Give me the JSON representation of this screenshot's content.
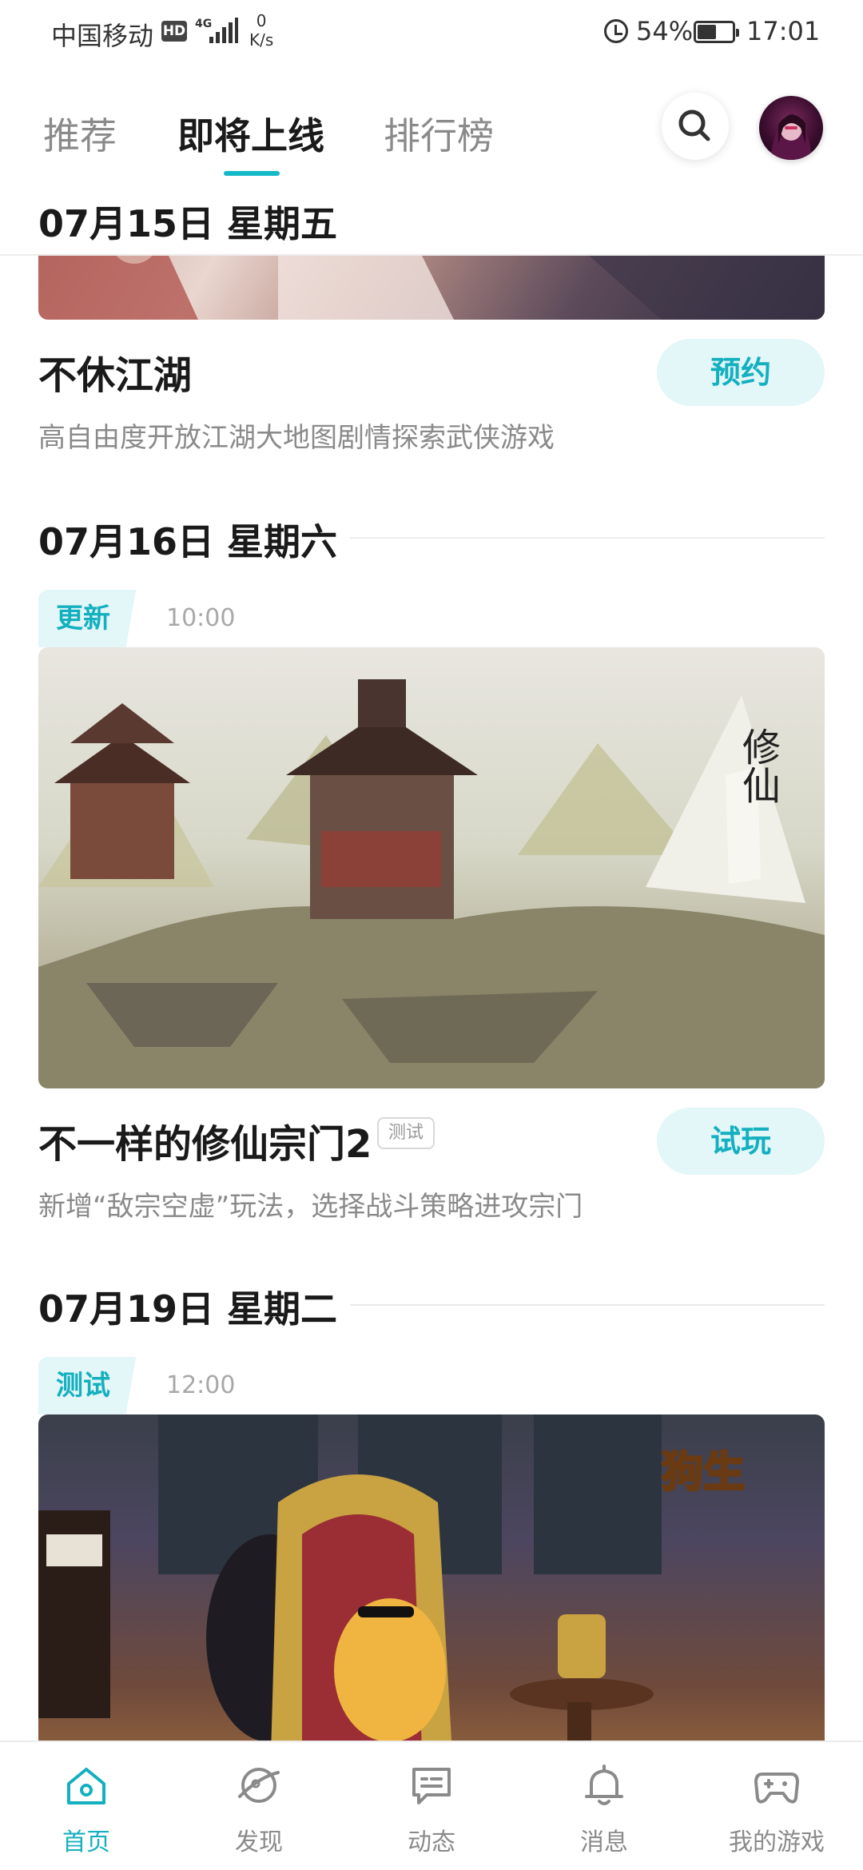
{
  "status_bar": {
    "carrier": "中国移动",
    "hd": "HD",
    "network": "4G",
    "speed_value": "0",
    "speed_unit": "K/s",
    "battery_percent": "54%",
    "battery_level": 0.54,
    "time": "17:01"
  },
  "top_tabs": {
    "items": [
      "推荐",
      "即将上线",
      "排行榜"
    ],
    "active_index": 1
  },
  "sticky_date": "07月15日 星期五",
  "games": [
    {
      "title": "不休江湖",
      "description": "高自由度开放江湖大地图剧情探索武侠游戏",
      "action": "预约"
    },
    {
      "date": "07月16日 星期六",
      "tag": "更新",
      "time": "10:00",
      "title": "不一样的修仙宗门2",
      "badge": "测试",
      "description": "新增“敌宗空虚”玩法，选择战斗策略进攻宗门",
      "action": "试玩"
    },
    {
      "date": "07月19日 星期二",
      "tag": "测试",
      "time": "12:00"
    }
  ],
  "bottom_nav": {
    "items": [
      "首页",
      "发现",
      "动态",
      "消息",
      "我的游戏"
    ],
    "active_index": 0
  },
  "colors": {
    "accent": "#14b0bf",
    "accent_bg": "#e3f6f8",
    "text_primary": "#1a1a1a",
    "text_secondary": "#8a8a8a"
  },
  "icons": [
    "search-icon",
    "home-icon",
    "discover-icon",
    "feed-icon",
    "bell-icon",
    "gamepad-icon",
    "alarm-icon",
    "battery-icon",
    "signal-icon"
  ]
}
